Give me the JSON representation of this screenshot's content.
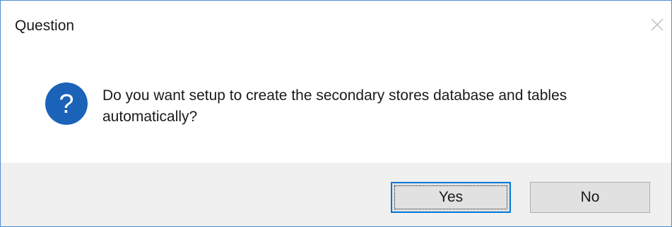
{
  "window": {
    "title": "Question"
  },
  "icons": {
    "close": "close-icon",
    "question": "question-icon"
  },
  "message": {
    "text": "Do you want setup to create the secondary stores database and tables automatically?"
  },
  "buttons": {
    "yes_label": "Yes",
    "no_label": "No"
  },
  "colors": {
    "border": "#4a8fd6",
    "icon_bg": "#1a63b8",
    "footer_bg": "#f0f0f0",
    "button_bg": "#e1e1e1",
    "focus_border": "#0078d7"
  }
}
